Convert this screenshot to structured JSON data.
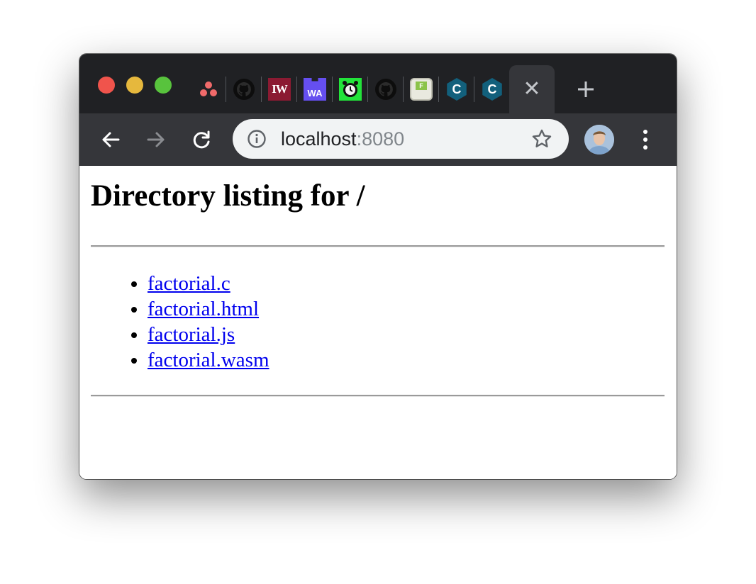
{
  "browser": {
    "tabs": [
      {
        "icon": "asana-icon",
        "label": ""
      },
      {
        "icon": "github-icon",
        "label": ""
      },
      {
        "icon": "iw-icon",
        "label": "IW"
      },
      {
        "icon": "webassembly-icon",
        "label": "WA"
      },
      {
        "icon": "alarm-clock-icon",
        "label": ""
      },
      {
        "icon": "github-icon",
        "label": ""
      },
      {
        "icon": "floppy-icon",
        "label": "F"
      },
      {
        "icon": "codacy-icon",
        "label": "C"
      },
      {
        "icon": "codacy-icon",
        "label": "C"
      }
    ],
    "active_tab": {
      "close_glyph": "✕"
    },
    "new_tab_glyph": "+",
    "address": {
      "host": "localhost",
      "port": ":8080"
    },
    "colors": {
      "tabstrip": "#202124",
      "toolbar": "#35363a",
      "omnibox": "#f1f3f4"
    }
  },
  "page": {
    "title": "Directory listing for /",
    "files": [
      {
        "name": "factorial.c"
      },
      {
        "name": "factorial.html"
      },
      {
        "name": "factorial.js"
      },
      {
        "name": "factorial.wasm"
      }
    ],
    "link_color": "#0000ee"
  }
}
